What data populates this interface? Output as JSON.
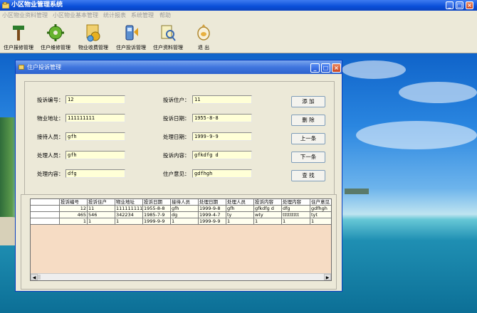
{
  "app": {
    "title": "小区物业管理系统",
    "menu": [
      "小区物业资料管理",
      "小区物业基本管理",
      "统计报表",
      "系统管理",
      "帮助"
    ],
    "toolbar": [
      {
        "label": "住户报修管理",
        "icon": "hammer-icon"
      },
      {
        "label": "住户维修管理",
        "icon": "gear-icon"
      },
      {
        "label": "物业收费管理",
        "icon": "coins-icon"
      },
      {
        "label": "住户投诉管理",
        "icon": "phone-icon"
      },
      {
        "label": "住户资料管理",
        "icon": "magnifier-icon"
      },
      {
        "label": "退 出",
        "icon": "exit-icon"
      }
    ]
  },
  "dialog": {
    "title": "住户投诉管理",
    "fields": {
      "complaint_no": {
        "label": "投诉编号：",
        "value": "12"
      },
      "complainant": {
        "label": "投诉住户：",
        "value": "11"
      },
      "property_address": {
        "label": "物业地址：",
        "value": "111111111"
      },
      "complaint_date": {
        "label": "投诉日期：",
        "value": "1955-8-8"
      },
      "receiver": {
        "label": "接待人员：",
        "value": "gfh"
      },
      "handle_date": {
        "label": "处理日期：",
        "value": "1999-9-9"
      },
      "handler": {
        "label": "处理人员：",
        "value": "gfh"
      },
      "complaint_content": {
        "label": "投诉内容：",
        "value": "gfkdfg d"
      },
      "handle_content": {
        "label": "处理内容：",
        "value": "dfg"
      },
      "resident_opinion": {
        "label": "住户意见：",
        "value": "gdfhgh"
      }
    },
    "buttons": {
      "add": "添 加",
      "delete": "删 除",
      "prev": "上一条",
      "next": "下一条",
      "find": "查 找"
    },
    "grid": {
      "columns": [
        "投诉编号",
        "投诉住户",
        "物业地址",
        "投诉日期",
        "接待人员",
        "处理日期",
        "处理人员",
        "投诉内容",
        "处理内容",
        "住户意见"
      ],
      "rows": [
        [
          "12",
          "11",
          "111111111",
          "1955-8-8",
          "gfh",
          "1999-9-8",
          "gfh",
          "gfkdfg d",
          "dfg",
          "gdfhgh"
        ],
        [
          "465",
          "546",
          "342234",
          "1985-7-9",
          "dg",
          "1999-4-7",
          "ty",
          "wty",
          "ttttttttt",
          "tyt"
        ],
        [
          "1",
          "1",
          "1",
          "1999-9-9",
          "1",
          "1999-9-9",
          "1",
          "1",
          "1",
          "1"
        ]
      ]
    }
  },
  "colors": {
    "titlebar": "#0a4fd8",
    "field_bg": "#ffffd7",
    "grid_bg": "#f6dcc4"
  }
}
